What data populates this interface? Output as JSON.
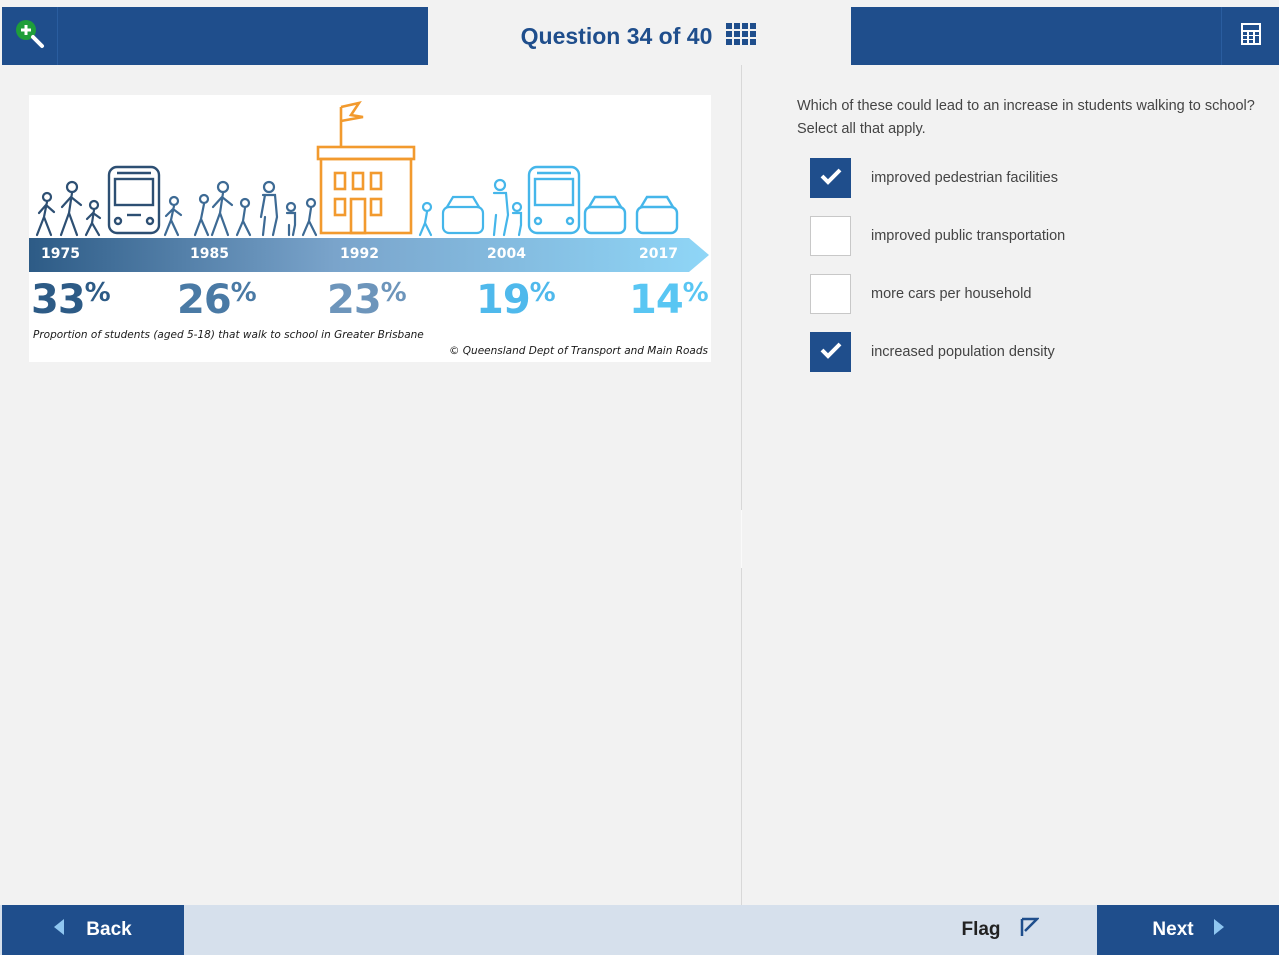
{
  "header": {
    "question_title": "Question 34 of 40",
    "zoom_icon": "zoom-in-icon",
    "grid_icon": "question-grid-icon",
    "calculator_icon": "calculator-icon"
  },
  "infographic": {
    "timeline": [
      {
        "year": "1975",
        "percent": "33",
        "color": "#2d5b86"
      },
      {
        "year": "1985",
        "percent": "26",
        "color": "#4a7aa5"
      },
      {
        "year": "1992",
        "percent": "23",
        "color": "#6d95bb"
      },
      {
        "year": "2004",
        "percent": "19",
        "color": "#4fb9ec"
      },
      {
        "year": "2017",
        "percent": "14",
        "color": "#59c6f3"
      }
    ],
    "percent_sign": "%",
    "caption": "Proportion of students (aged 5-18) that walk to school in Greater Brisbane",
    "credit": "© Queensland Dept of Transport and Main Roads"
  },
  "question": {
    "text": "Which of these could lead to an increase in students walking to school? Select all that apply.",
    "options": [
      {
        "label": "improved pedestrian facilities",
        "checked": true
      },
      {
        "label": "improved public transportation",
        "checked": false
      },
      {
        "label": "more cars per household",
        "checked": false
      },
      {
        "label": "increased population density",
        "checked": true
      }
    ]
  },
  "footer": {
    "back_label": "Back",
    "flag_label": "Flag",
    "next_label": "Next"
  },
  "colors": {
    "brand_blue": "#1f4e8c",
    "school_orange": "#f29a2e",
    "footer_bg": "#d6e0ec"
  }
}
